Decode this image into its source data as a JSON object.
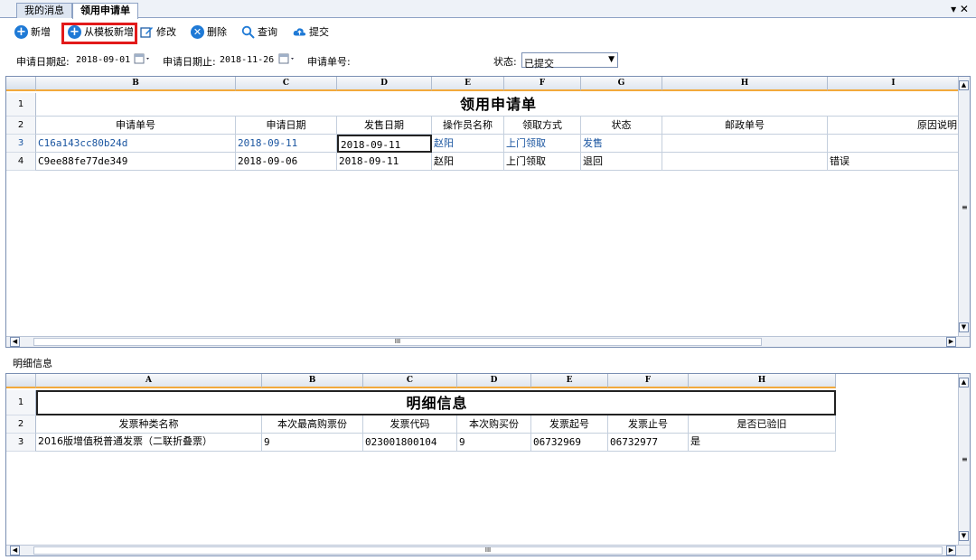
{
  "tabs": [
    {
      "label": "我的消息"
    },
    {
      "label": "领用申请单"
    }
  ],
  "window_controls": "▾ ✕",
  "toolbar": {
    "add": "新增",
    "add_from_template": "从模板新增",
    "edit": "修改",
    "delete": "删除",
    "query": "查询",
    "submit": "提交"
  },
  "filter": {
    "date_from_label": "申请日期起:",
    "date_from": "2018-09-01",
    "date_to_label": "申请日期止:",
    "date_to": "2018-11-26",
    "order_no_label": "申请单号:",
    "status_label": "状态:",
    "status_value": "已提交"
  },
  "grid1": {
    "columns": [
      "B",
      "C",
      "D",
      "E",
      "F",
      "G",
      "H",
      "I"
    ],
    "row_numbers": [
      "1",
      "2",
      "3",
      "4"
    ],
    "title": "领用申请单",
    "headers": [
      "申请单号",
      "申请日期",
      "发售日期",
      "操作员名称",
      "领取方式",
      "状态",
      "邮政单号",
      "原因说明"
    ],
    "rows": [
      [
        "C16a143cc80b24d",
        "2018-09-11",
        "2018-09-11",
        "赵阳",
        "上门领取",
        "发售",
        "",
        ""
      ],
      [
        "C9ee88fe77de349",
        "2018-09-06",
        "2018-09-11",
        "赵阳",
        "上门领取",
        "退回",
        "",
        "错误"
      ]
    ],
    "scroll_mark": "III"
  },
  "detail_label": "明细信息",
  "grid2": {
    "columns": [
      "A",
      "B",
      "C",
      "D",
      "E",
      "F",
      "H"
    ],
    "row_numbers": [
      "1",
      "2",
      "3"
    ],
    "title": "明细信息",
    "headers": [
      "发票种类名称",
      "本次最高购票份",
      "发票代码",
      "本次购买份",
      "发票起号",
      "发票止号",
      "是否已验旧"
    ],
    "rows": [
      [
        "2016版增值税普通发票（二联折叠票）",
        "9",
        "023001800104",
        "9",
        "06732969",
        "06732977",
        "是"
      ]
    ],
    "scroll_mark": "III"
  },
  "colors": {
    "accent": "#1f7ad6",
    "highlight": "#e21a1a",
    "header_rule": "#f2a93b"
  }
}
